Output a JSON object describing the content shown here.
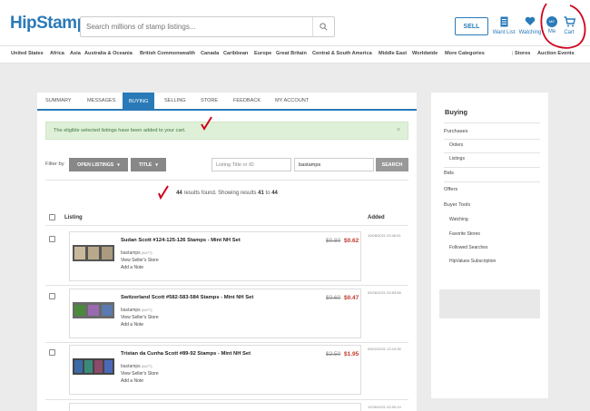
{
  "header": {
    "logo": "HipStamp",
    "search_placeholder": "Search millions of stamp listings...",
    "sell_label": "SELL",
    "want_list": "Want List",
    "watching": "Watching",
    "me": "Me",
    "me_badge": "ME",
    "cart": "Cart"
  },
  "categories": [
    "United States",
    "Africa",
    "Asia",
    "Australia & Oceania",
    "British Commonwealth",
    "Canada",
    "Caribbean",
    "Europe",
    "Great Britain",
    "Central & South America",
    "Middle East",
    "Worldwide",
    "More Categories"
  ],
  "right_links": [
    "Stores",
    "Auction Events"
  ],
  "tabs": [
    "SUMMARY",
    "MESSAGES",
    "BUYING",
    "SELLING",
    "STORE",
    "FEEDBACK",
    "MY ACCOUNT"
  ],
  "alert": {
    "message": "The eligible selected listings have been added to your cart.",
    "close": "×"
  },
  "filters": {
    "label": "Filter by",
    "open_listings": "OPEN LISTINGS",
    "title": "TITLE",
    "search_placeholder": "Listing Title or ID",
    "seller_value": "bastamps",
    "search_button": "SEARCH"
  },
  "results": {
    "count": "44",
    "text1": " results found. Showing results ",
    "from": "41",
    "to_word": " to ",
    "to": "44"
  },
  "columns": {
    "listing": "Listing",
    "added": "Added"
  },
  "listings": [
    {
      "title": "Sudan Scott #124-125-126 Stamps - Mint NH Set",
      "seller": "bastamps",
      "seller_count": "(6477)",
      "store_link": "View Seller's Store",
      "note_link": "Add a Note",
      "old_price": "$0.80",
      "new_price": "$0.62",
      "added": "10/08/2021 03:06:51"
    },
    {
      "title": "Switzerland Scott #582-583-584 Stamps - Mint NH Set",
      "seller": "bastamps",
      "seller_count": "(6477)",
      "store_link": "View Seller's Store",
      "note_link": "Add a Note",
      "old_price": "$0.60",
      "new_price": "$0.47",
      "added": "09/26/2021 03:53:58"
    },
    {
      "title": "Tristan da Cunha Scott #89-92 Stamps - Mint NH Set",
      "seller": "bastamps",
      "seller_count": "(6477)",
      "store_link": "View Seller's Store",
      "note_link": "Add a Note",
      "old_price": "$2.50",
      "new_price": "$1.95",
      "added": "09/02/2021 13:19:36"
    }
  ],
  "next_added": "12/26/2021 02:00:14",
  "sidebar": {
    "title": "Buying",
    "purchases": "Purchases",
    "orders": "Orders",
    "listings": "Listings",
    "bids": "Bids",
    "offers": "Offers",
    "buyer_tools": "Buyer Tools",
    "watching": "Watching",
    "favorite_stores": "Favorite Stores",
    "followed_searches": "Followed Searches",
    "hv_subscription": "HipValues Subscription"
  },
  "colors": {
    "brand": "#2a7ab8",
    "sale": "#c0392b",
    "alert_bg": "#dff0d8",
    "annotation": "#d0021b"
  }
}
